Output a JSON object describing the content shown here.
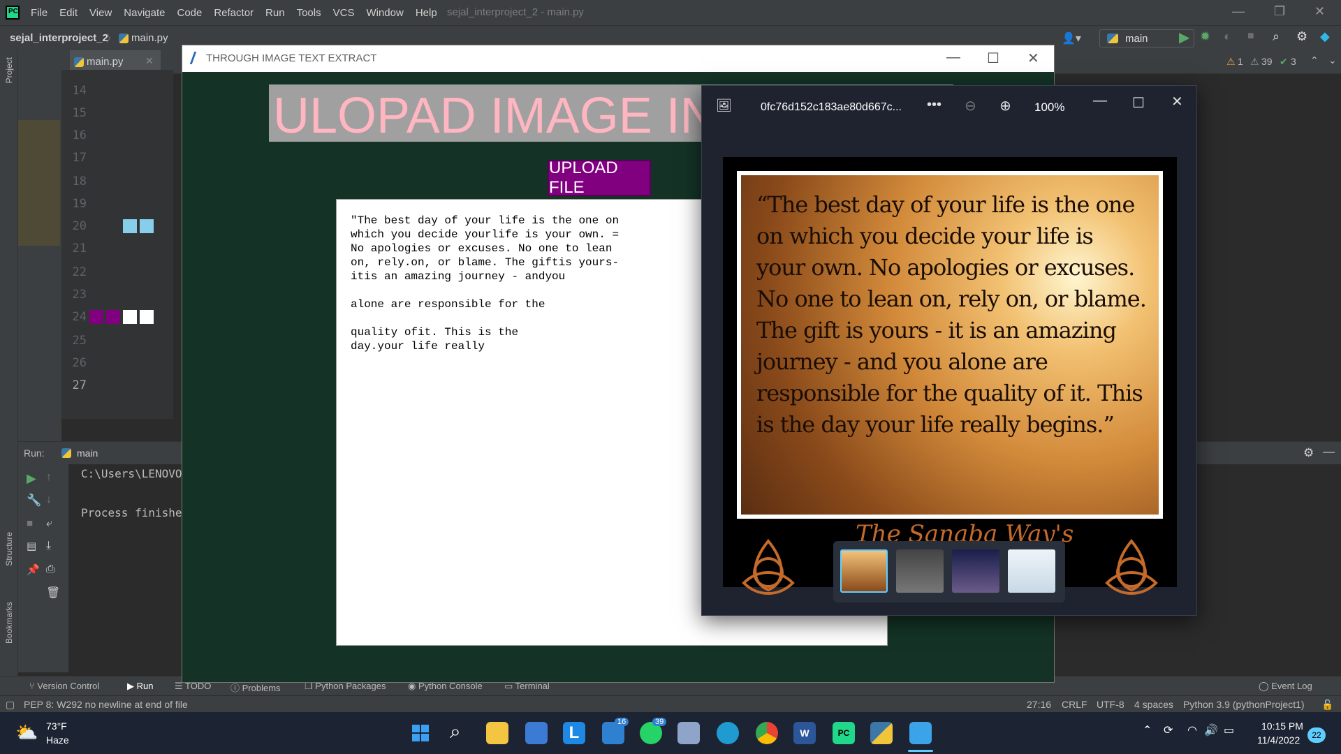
{
  "ide": {
    "menus": [
      "File",
      "Edit",
      "View",
      "Navigate",
      "Code",
      "Refactor",
      "Run",
      "Tools",
      "VCS",
      "Window",
      "Help"
    ],
    "window_title": "sejal_interproject_2 - main.py",
    "project": "sejal_interproject_2",
    "file": "main.py",
    "run_config": "main",
    "inspections": {
      "warnings": "1",
      "weak_warnings": "39",
      "typos": "3"
    },
    "line_numbers": [
      "14",
      "15",
      "16",
      "17",
      "18",
      "19",
      "20",
      "21",
      "22",
      "23",
      "24",
      "25",
      "26",
      "27"
    ],
    "left_tools": [
      "Project",
      "Structure",
      "Bookmarks"
    ],
    "run_panel": {
      "label": "Run:",
      "tab": "main",
      "console_line1": "C:\\Users\\LENOVO",
      "console_line2": "Process finishe"
    },
    "bottom_tools": [
      "Version Control",
      "Run",
      "TODO",
      "Problems",
      "Python Packages",
      "Python Console",
      "Terminal",
      "Event Log"
    ],
    "status": {
      "message": "PEP 8: W292 no newline at end of file",
      "position": "27:16",
      "line_sep": "CRLF",
      "encoding": "UTF-8",
      "indent": "4 spaces",
      "interpreter": "Python 3.9 (pythonProject1)"
    }
  },
  "app": {
    "title": "THROUGH IMAGE TEXT EXTRACT",
    "heading": "ULOPAD IMAGE IN I",
    "upload_label": "UPLOAD FILE",
    "extracted_text": "\"The best day of your life is the one on\nwhich you decide yourlife is your own. =\nNo apologies or excuses. No one to lean\non, rely.on, or blame. The giftis yours-\nitis an amazing journey - andyou\n\nalone are responsible for the\n\nquality ofit. This is the\nday.your life really",
    "colors": {
      "bg": "#143326",
      "button": "#800080",
      "heading_fg": "#ffb6c1",
      "heading_bg": "#a0a0a0"
    }
  },
  "photos": {
    "filename": "0fc76d152c183ae80d667c...",
    "zoom": "100%",
    "quote": "“The best day of your life is the one on which you decide your life is your own. No apologies or excuses. No one to lean on, rely on, or blame. The gift is yours - it is an amazing journey - and you alone are responsible for the quality of it. This is the day your life really begins.”",
    "footer": "The Sanaba Way's"
  },
  "taskbar": {
    "weather_temp": "73°F",
    "weather_desc": "Haze",
    "mail_badge": "16",
    "whatsapp_badge": "39",
    "time": "10:15 PM",
    "date": "11/4/2022",
    "notif_count": "22"
  }
}
